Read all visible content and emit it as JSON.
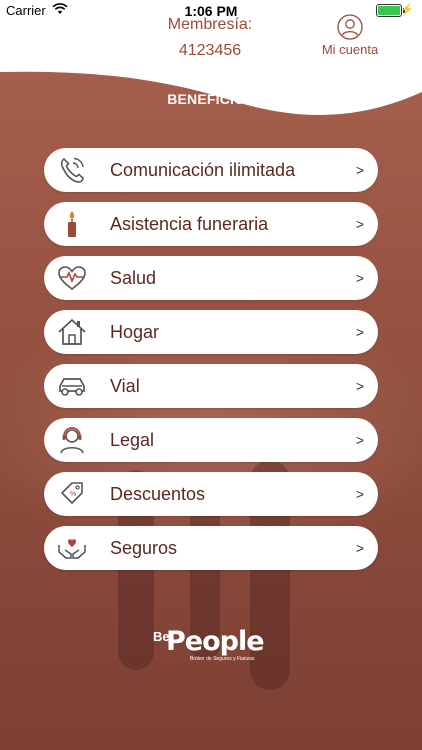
{
  "status_bar": {
    "carrier": "Carrier",
    "time": "1:06 PM",
    "wifi_icon": "wifi-icon",
    "battery_icon": "battery-charging-icon",
    "battery_level": 1.0
  },
  "header": {
    "membership_label": "Membresía:",
    "membership_number": "4123456",
    "account_label": "Mi cuenta",
    "account_icon": "user-circle-icon"
  },
  "section_title": "BENEFICIOS",
  "menu": [
    {
      "label": "Comunicación ilimitada",
      "icon": "phone-icon",
      "chevron": ">"
    },
    {
      "label": "Asistencia funeraria",
      "icon": "candle-icon",
      "chevron": ">"
    },
    {
      "label": "Salud",
      "icon": "heart-pulse-icon",
      "chevron": ">"
    },
    {
      "label": "Hogar",
      "icon": "house-icon",
      "chevron": ">"
    },
    {
      "label": "Vial",
      "icon": "car-icon",
      "chevron": ">"
    },
    {
      "label": "Legal",
      "icon": "headset-agent-icon",
      "chevron": ">"
    },
    {
      "label": "Descuentos",
      "icon": "discount-tag-icon",
      "chevron": ">"
    },
    {
      "label": "Seguros",
      "icon": "hands-heart-icon",
      "chevron": ">"
    }
  ],
  "logo": {
    "prefix": "Be",
    "name": "People",
    "tagline": "Bróker de Seguros y Fianzas"
  },
  "colors": {
    "accent": "#9b4b37",
    "background": "#9a5544",
    "item_background": "#ffffff",
    "text": "#5a2a20"
  }
}
